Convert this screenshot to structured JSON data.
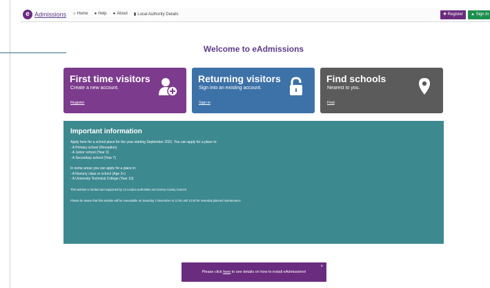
{
  "navbar": {
    "brand_logo": "e",
    "brand": "Admissions",
    "links": [
      {
        "icon": "home-icon",
        "label": "Home"
      },
      {
        "icon": "help-icon",
        "label": "Help"
      },
      {
        "icon": "info-icon",
        "label": "About"
      },
      {
        "icon": "building-icon",
        "label": "Local Authority Details"
      }
    ],
    "register_label": "Register",
    "signin_label": "Sign In"
  },
  "page_title": "Welcome to eAdmissions",
  "tiles": [
    {
      "title": "First time visitors",
      "subtitle": "Create a new account.",
      "link": "Register",
      "icon": "add-user-icon",
      "color": "#7c3b8c"
    },
    {
      "title": "Returning visitors",
      "subtitle": "Sign into an existing account.",
      "link": "Sign in",
      "icon": "padlock-icon",
      "color": "#3d72a8"
    },
    {
      "title": "Find schools",
      "subtitle": "Nearest to you.",
      "link": "Find",
      "icon": "location-pin-icon",
      "color": "#5b5b5b"
    }
  ],
  "info": {
    "title": "Important information",
    "intro": "Apply here for a school place for the year starting September 2021. You can apply for a place in:",
    "places": [
      "- A Primary school (Reception)",
      "- A Junior school (Year 3)",
      "- A Secondary school (Year 7)"
    ],
    "some_areas": "In some areas you can apply for a place in:",
    "some_places": [
      "- A Nursery class or school (Age 3+)",
      "- A University Technical College (Year 10)"
    ],
    "funding_note": "This website is funded and supported by 13 London authorities and Surrey County Council.",
    "maintenance_note": "Please be aware that this website will be unavailable on Saturday 2 November at 11:00 until 12:30 for essential planned maintenance.",
    "background": "#3d8990"
  },
  "banner": {
    "prefix": "Please click",
    "link": "here",
    "suffix": "to see details on how to install eAdmissions!",
    "close": "×"
  }
}
